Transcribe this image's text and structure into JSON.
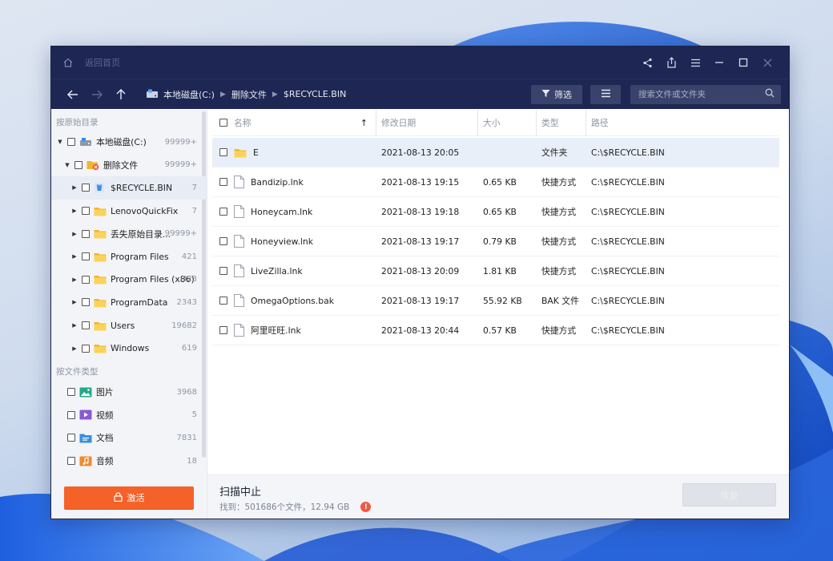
{
  "titlebar": {
    "back_home_label": "返回首页"
  },
  "breadcrumb": [
    "本地磁盘(C:)",
    "删除文件",
    "$RECYCLE.BIN"
  ],
  "toolbar": {
    "filter_label": "筛选",
    "search_placeholder": "搜索文件或文件夹"
  },
  "sidebar": {
    "section_original": "按原始目录",
    "tree": [
      {
        "label": "本地磁盘(C:)",
        "count": "99999+",
        "level": 0,
        "expanded": true,
        "icon": "drive-icon"
      },
      {
        "label": "删除文件",
        "count": "99999+",
        "level": 1,
        "expanded": true,
        "icon": "deleted-folder-icon"
      },
      {
        "label": "$RECYCLE.BIN",
        "count": "7",
        "level": 2,
        "expanded": false,
        "icon": "recycle-bin-icon",
        "selected": true
      },
      {
        "label": "LenovoQuickFix",
        "count": "7",
        "level": 2,
        "expanded": false,
        "icon": "folder-icon"
      },
      {
        "label": "丢失原始目录...",
        "count": "99999+",
        "level": 2,
        "expanded": false,
        "icon": "folder-icon"
      },
      {
        "label": "Program Files",
        "count": "421",
        "level": 2,
        "expanded": false,
        "icon": "folder-icon"
      },
      {
        "label": "Program Files (x86)",
        "count": "323",
        "level": 2,
        "expanded": false,
        "icon": "folder-icon"
      },
      {
        "label": "ProgramData",
        "count": "2343",
        "level": 2,
        "expanded": false,
        "icon": "folder-icon"
      },
      {
        "label": "Users",
        "count": "19682",
        "level": 2,
        "expanded": false,
        "icon": "folder-icon"
      },
      {
        "label": "Windows",
        "count": "619",
        "level": 2,
        "expanded": false,
        "icon": "folder-icon"
      }
    ],
    "section_type": "按文件类型",
    "types": [
      {
        "label": "图片",
        "count": "3968",
        "icon": "image-icon",
        "color": "#22a98a"
      },
      {
        "label": "视频",
        "count": "5",
        "icon": "video-icon",
        "color": "#8a58d6"
      },
      {
        "label": "文档",
        "count": "7831",
        "icon": "document-icon",
        "color": "#3b8ee0"
      },
      {
        "label": "音频",
        "count": "18",
        "icon": "audio-icon",
        "color": "#f08a2c"
      }
    ],
    "activate_label": "激活"
  },
  "table": {
    "headers": {
      "name": "名称",
      "date": "修改日期",
      "size": "大小",
      "type": "类型",
      "path": "路径"
    },
    "rows": [
      {
        "name": "E",
        "date": "2021-08-13 20:05",
        "size": "",
        "type": "文件夹",
        "path": "C:\\$RECYCLE.BIN",
        "icon": "folder-icon",
        "selected": true
      },
      {
        "name": "Bandizip.lnk",
        "date": "2021-08-13 19:15",
        "size": "0.65 KB",
        "type": "快捷方式",
        "path": "C:\\$RECYCLE.BIN",
        "icon": "file-icon"
      },
      {
        "name": "Honeycam.lnk",
        "date": "2021-08-13 19:18",
        "size": "0.65 KB",
        "type": "快捷方式",
        "path": "C:\\$RECYCLE.BIN",
        "icon": "file-icon"
      },
      {
        "name": "Honeyview.lnk",
        "date": "2021-08-13 19:17",
        "size": "0.79 KB",
        "type": "快捷方式",
        "path": "C:\\$RECYCLE.BIN",
        "icon": "file-icon"
      },
      {
        "name": "LiveZilla.lnk",
        "date": "2021-08-13 20:09",
        "size": "1.81 KB",
        "type": "快捷方式",
        "path": "C:\\$RECYCLE.BIN",
        "icon": "file-icon"
      },
      {
        "name": "OmegaOptions.bak",
        "date": "2021-08-13 19:17",
        "size": "55.92 KB",
        "type": "BAK 文件",
        "path": "C:\\$RECYCLE.BIN",
        "icon": "file-icon"
      },
      {
        "name": "阿里旺旺.lnk",
        "date": "2021-08-13 20:44",
        "size": "0.57 KB",
        "type": "快捷方式",
        "path": "C:\\$RECYCLE.BIN",
        "icon": "file-icon"
      }
    ]
  },
  "status": {
    "title": "扫描中止",
    "found_text": "找到：501686个文件，12.94 GB",
    "recover_label": "恢复"
  },
  "colors": {
    "titlebar": "#1e2753",
    "accent_orange": "#f4622a",
    "folder": "#f7c23a",
    "warning": "#f05a43"
  }
}
